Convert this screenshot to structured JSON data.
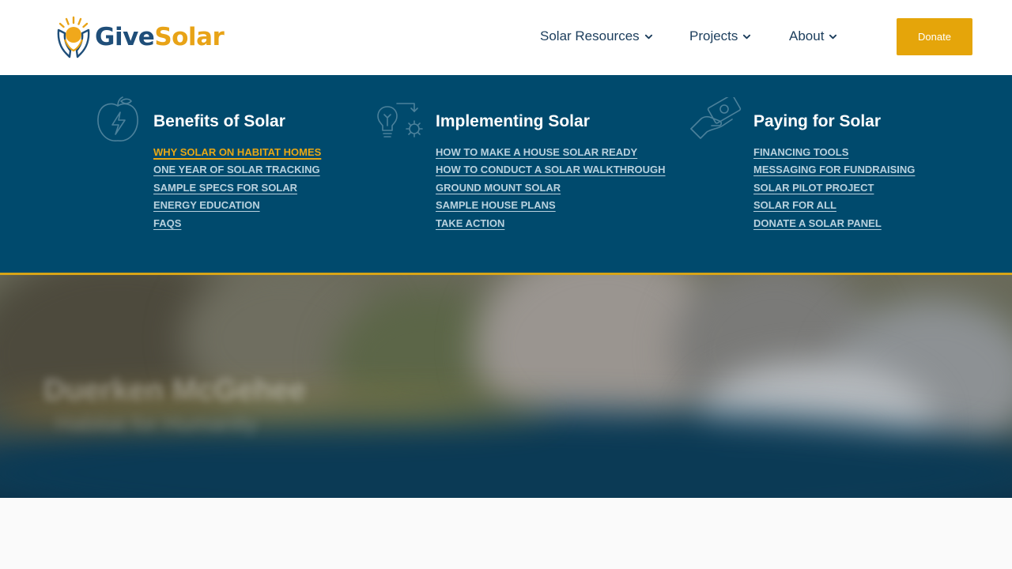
{
  "brand": {
    "name_part1": "Give",
    "name_part2": "Solar",
    "color_primary": "#1f4e79",
    "color_accent": "#e8a317"
  },
  "nav": {
    "items": [
      {
        "label": "Solar Resources",
        "icon": "chevron-down-icon"
      },
      {
        "label": "Projects",
        "icon": "chevron-down-icon"
      },
      {
        "label": "About",
        "icon": "chevron-down-icon"
      }
    ],
    "donate_label": "Donate"
  },
  "mega_menu": {
    "background": "#004a6d",
    "columns": [
      {
        "title": "Benefits of Solar",
        "icon": "apple-lightning-icon",
        "links": [
          "WHY SOLAR ON HABITAT HOMES",
          "ONE YEAR OF SOLAR TRACKING",
          "SAMPLE SPECS FOR SOLAR",
          "ENERGY EDUCATION",
          "FAQS"
        ],
        "active_index": 0
      },
      {
        "title": "Implementing Solar",
        "icon": "lightbulb-gear-icon",
        "links": [
          "HOW TO MAKE A HOUSE SOLAR READY",
          "HOW TO CONDUCT A SOLAR WALKTHROUGH",
          "GROUND MOUNT SOLAR",
          "SAMPLE HOUSE PLANS",
          "TAKE ACTION"
        ]
      },
      {
        "title": "Paying for Solar",
        "icon": "hand-money-icon",
        "links": [
          "FINANCING TOOLS",
          "MESSAGING FOR FUNDRAISING",
          "SOLAR PILOT PROJECT",
          "SOLAR FOR ALL",
          "DONATE A SOLAR PANEL"
        ]
      }
    ]
  },
  "hero": {
    "blurred_title": "Duerken McGehee",
    "blurred_subtitle": "Habitat for Humanity"
  }
}
